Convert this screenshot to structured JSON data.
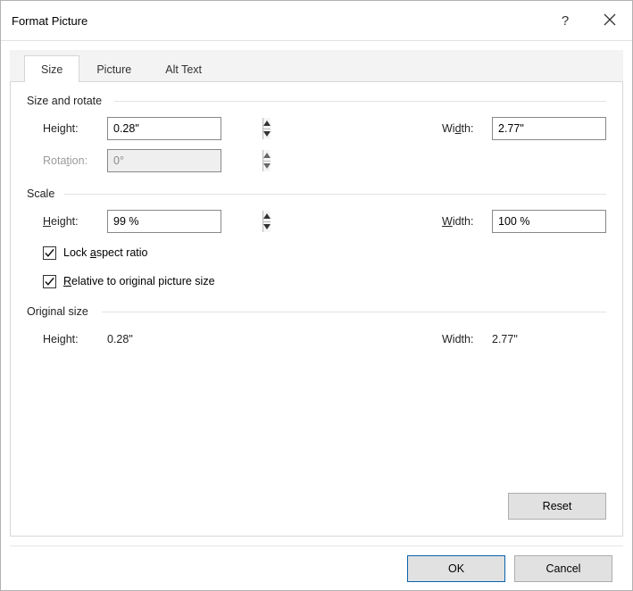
{
  "window": {
    "title": "Format Picture"
  },
  "tabs": {
    "size": "Size",
    "picture": "Picture",
    "alttext": "Alt Text"
  },
  "section": {
    "size_rotate": "Size and rotate",
    "scale": "Scale",
    "original": "Original size"
  },
  "labels": {
    "height_h": "H",
    "height_rest": "eight:",
    "width_w": "Wi",
    "width_d": "d",
    "width_rest": "th:",
    "rotation_r": "Rota",
    "rotation_t": "t",
    "rotation_rest": "ion:",
    "height2_h": "H",
    "height2_rest": "eight:",
    "width2_w": "W",
    "width2_i": "i",
    "width2_rest": "dth:",
    "height3": "Height:",
    "width3": "Width:",
    "lock_a": "Lock ",
    "lock_u": "a",
    "lock_rest": "spect ratio",
    "rel_r": "R",
    "rel_rest": "elative to original picture size"
  },
  "values": {
    "height": "0.28\"",
    "width": "2.77\"",
    "rotation": "0°",
    "scale_height": "99 %",
    "scale_width": "100 %",
    "orig_height": "0.28\"",
    "orig_width": "2.77\""
  },
  "checks": {
    "lock": true,
    "relative": true
  },
  "buttons": {
    "reset": "Reset",
    "ok": "OK",
    "cancel": "Cancel"
  }
}
